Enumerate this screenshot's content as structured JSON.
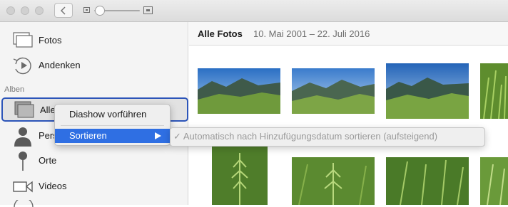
{
  "window": {
    "traffic_lights": [
      "close",
      "minimize",
      "zoom"
    ]
  },
  "toolbar": {
    "back_icon": "chevron-left-icon",
    "zoom_slider_value": 0.02
  },
  "sidebar": {
    "items": [
      {
        "label": "Fotos",
        "icon": "photos-stack-icon"
      },
      {
        "label": "Andenken",
        "icon": "memories-play-icon"
      }
    ],
    "section_title": "Alben",
    "albums": [
      {
        "label": "Alle Fotos",
        "icon": "album-stack-icon",
        "selected": true
      },
      {
        "label": "Personen",
        "icon": "person-icon"
      },
      {
        "label": "Orte",
        "icon": "map-pin-icon"
      },
      {
        "label": "Videos",
        "icon": "video-camera-icon"
      }
    ]
  },
  "main": {
    "title": "Alle Fotos",
    "date_range": "10. Mai 2001 – 22. Juli 2016"
  },
  "context_menu": {
    "items": [
      {
        "label": "Diashow vorführen"
      },
      {
        "label": "Sortieren",
        "has_submenu": true,
        "highlighted": true
      }
    ],
    "submenu": {
      "items": [
        {
          "label": "Automatisch nach Hinzufügungsdatum sortieren (aufsteigend)",
          "checked": true,
          "enabled": false
        }
      ]
    }
  },
  "colors": {
    "selection_border": "#2c55b9",
    "menu_highlight": "#2f6fe3"
  }
}
